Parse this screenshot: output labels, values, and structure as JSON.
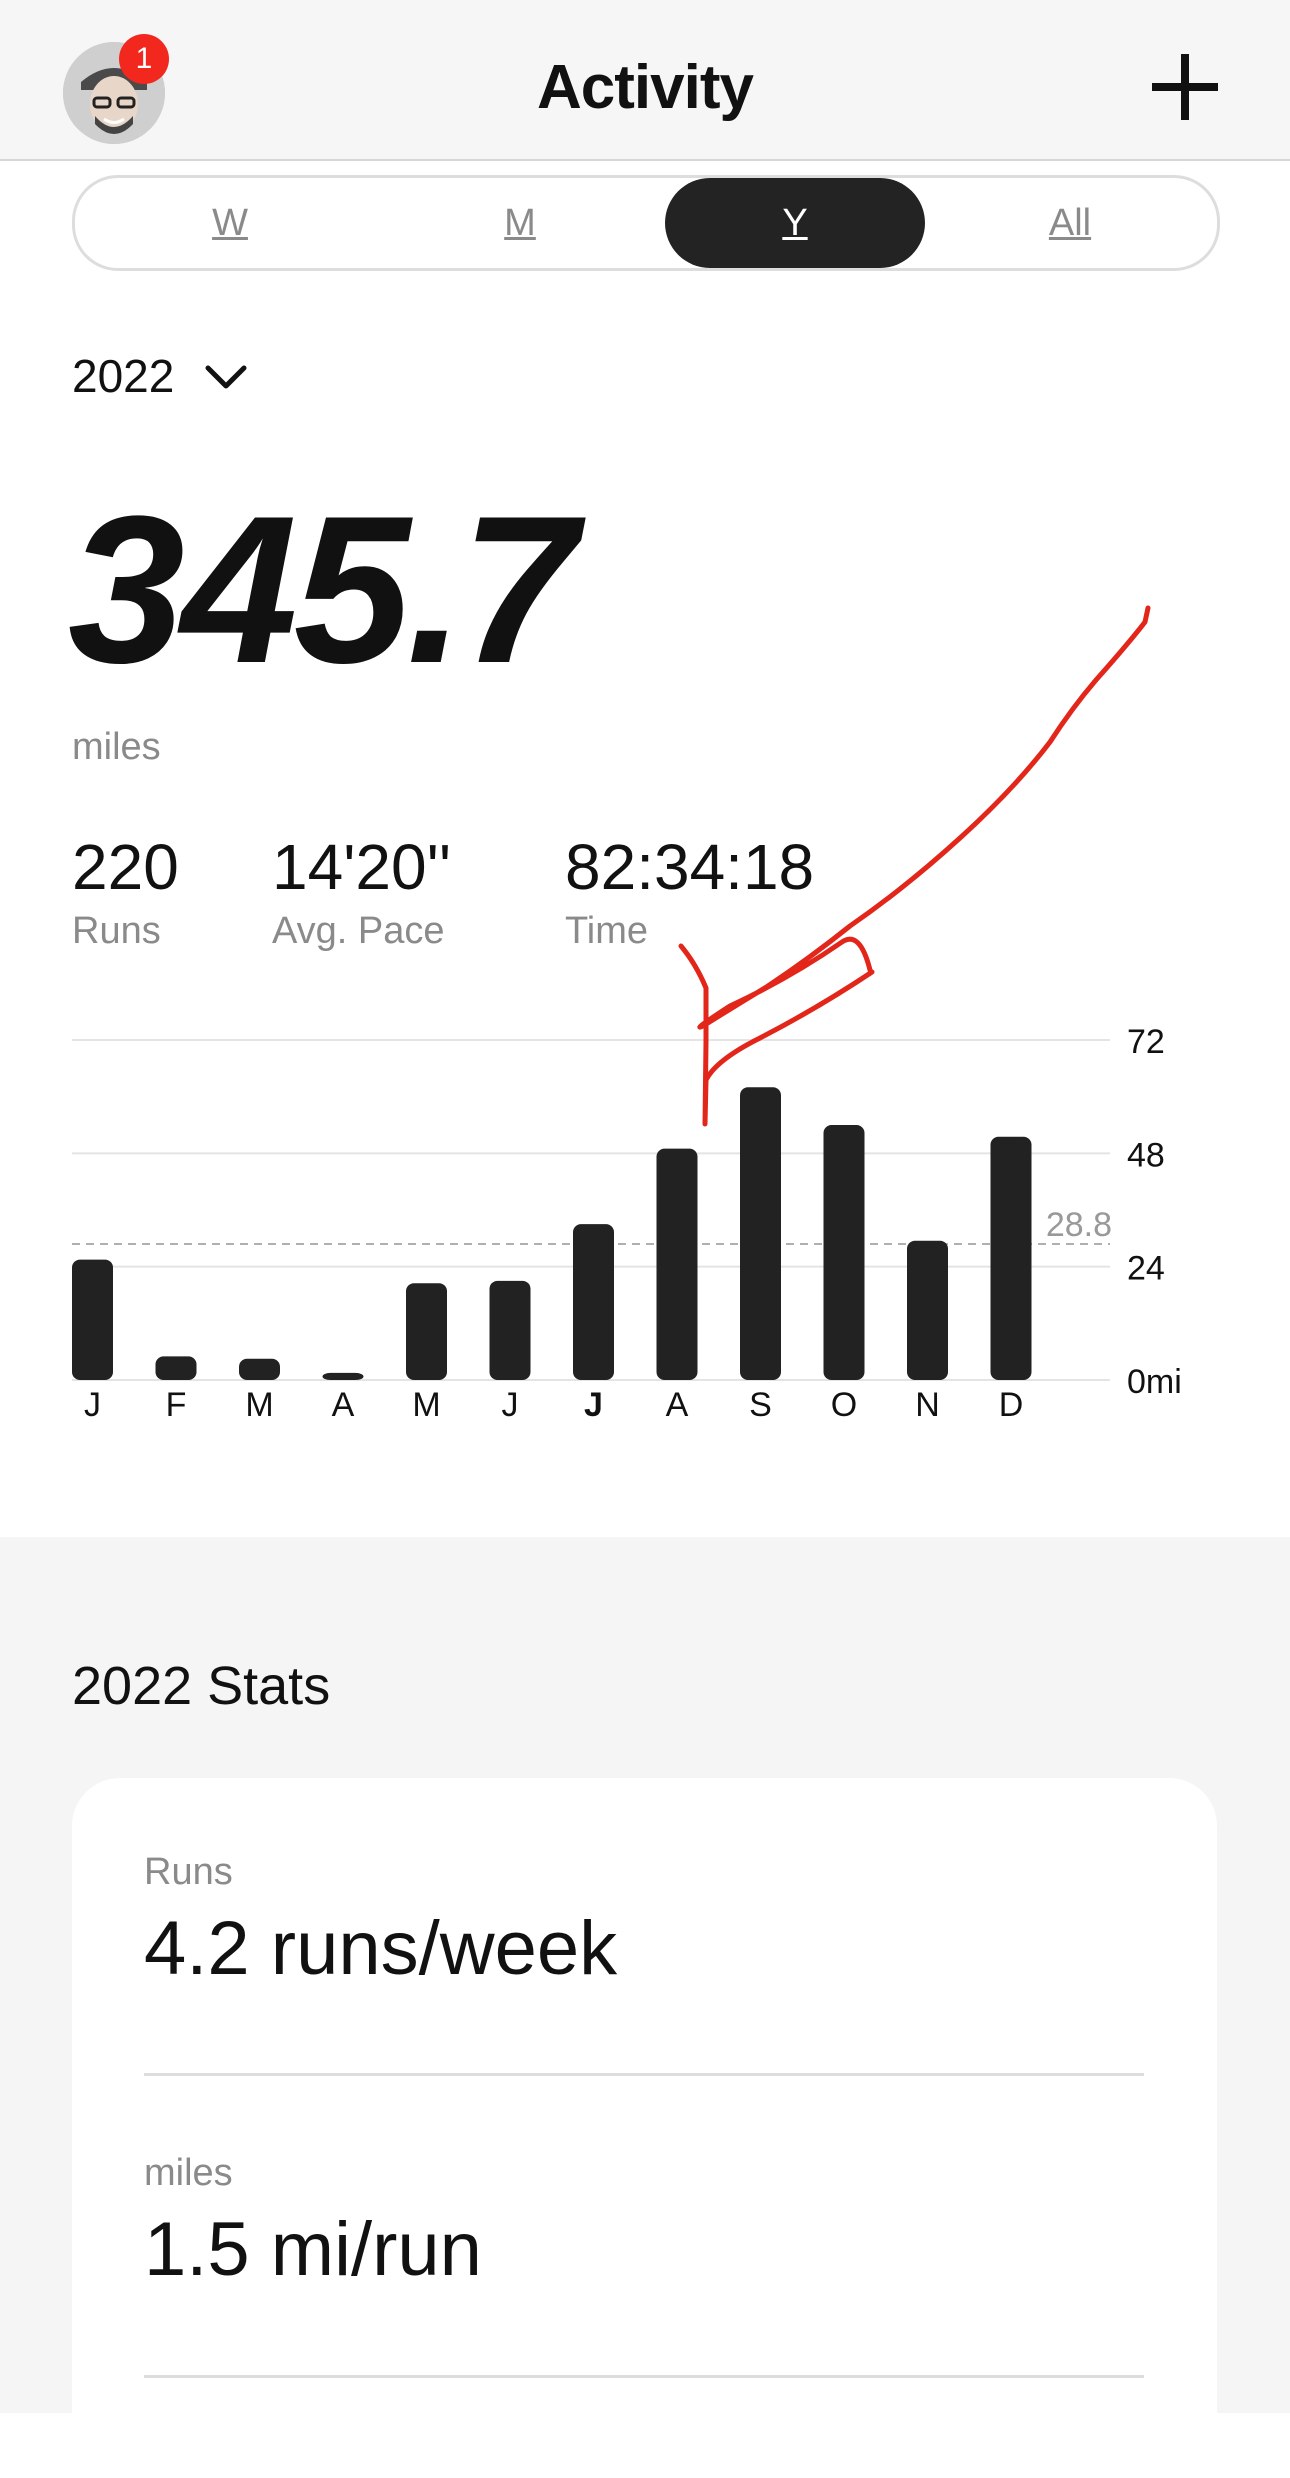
{
  "header": {
    "title": "Activity",
    "notification_count": "1"
  },
  "period_tabs": [
    {
      "label": "W",
      "active": false
    },
    {
      "label": "M",
      "active": false
    },
    {
      "label": "Y",
      "active": true
    },
    {
      "label": "All",
      "active": false
    }
  ],
  "year_selector": {
    "value": "2022"
  },
  "summary": {
    "distance": "345.7",
    "units": "miles",
    "stats": [
      {
        "value": "220",
        "label": "Runs"
      },
      {
        "value": "14'20''",
        "label": "Avg. Pace"
      },
      {
        "value": "82:34:18",
        "label": "Time"
      }
    ]
  },
  "chart_data": {
    "type": "bar",
    "categories": [
      "J",
      "F",
      "M",
      "A",
      "M",
      "J",
      "J",
      "A",
      "S",
      "O",
      "N",
      "D"
    ],
    "values": [
      25.5,
      5,
      4.5,
      1.5,
      20.5,
      21,
      33,
      49,
      62,
      54,
      29.5,
      51.5
    ],
    "highlighted_category_index": 6,
    "y_ticks": [
      "72",
      "48",
      "24",
      "0mi"
    ],
    "y_tick_values": [
      72,
      48,
      24,
      0
    ],
    "ylim": [
      0,
      72
    ],
    "average": {
      "value": 28.8,
      "label": "28.8"
    },
    "grid": true,
    "colors": {
      "bar": "#222222",
      "grid": "#e4e4e4",
      "average_line": "#b0b0b0"
    }
  },
  "annotation": {
    "color": "#e2261a"
  },
  "stats_section": {
    "title": "2022 Stats",
    "items": [
      {
        "label": "Runs",
        "value": "4.2 runs/week"
      },
      {
        "label": "miles",
        "value": "1.5 mi/run"
      }
    ]
  }
}
